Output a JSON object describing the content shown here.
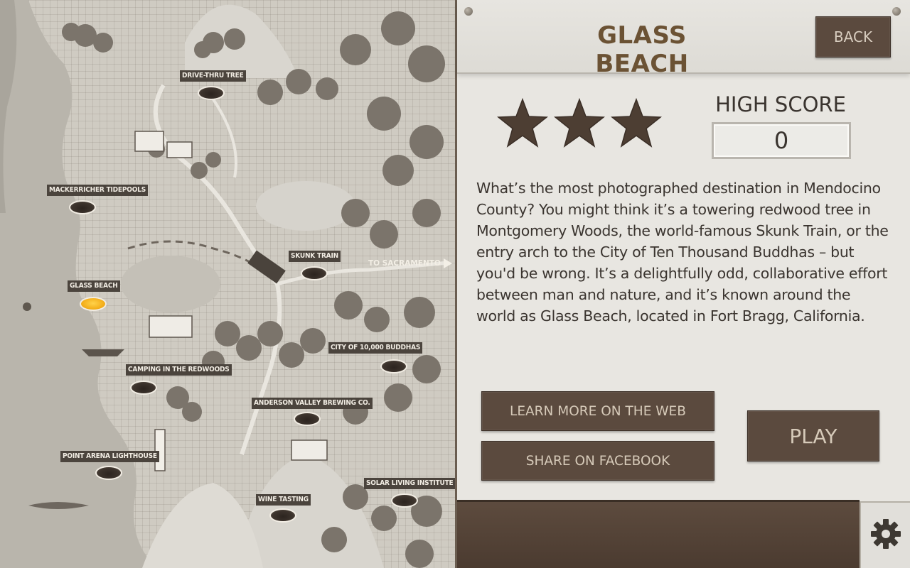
{
  "map": {
    "locations": [
      {
        "id": "drive-thru-tree",
        "label": "DRIVE-THRU TREE",
        "active": false
      },
      {
        "id": "mackerricher-tidepools",
        "label": "MACKERRICHER TIDEPOOLS",
        "active": false
      },
      {
        "id": "skunk-train",
        "label": "SKUNK TRAIN",
        "active": false
      },
      {
        "id": "glass-beach",
        "label": "GLASS BEACH",
        "active": true
      },
      {
        "id": "city-of-10000-buddhas",
        "label": "CITY OF 10,000 BUDDHAS",
        "active": false
      },
      {
        "id": "camping-in-the-redwoods",
        "label": "CAMPING IN THE REDWOODS",
        "active": false
      },
      {
        "id": "anderson-valley-brewing",
        "label": "ANDERSON VALLEY BREWING CO.",
        "active": false
      },
      {
        "id": "point-arena-lighthouse",
        "label": "POINT ARENA LIGHTHOUSE",
        "active": false
      },
      {
        "id": "solar-living-institute",
        "label": "SOLAR LIVING INSTITUTE",
        "active": false
      },
      {
        "id": "wine-tasting",
        "label": "WINE TASTING",
        "active": false
      }
    ],
    "to_sacramento": "TO SACRAMENTO"
  },
  "panel": {
    "title": "GLASS BEACH",
    "back_label": "BACK",
    "stars_earned": 3,
    "stars_total": 3,
    "high_score_label": "HIGH SCORE",
    "high_score_value": "0",
    "description": "What’s the most photographed destination in Mendocino County? You might think it’s a towering redwood tree in Montgomery Woods, the world-famous Skunk Train, or the entry arch to the City of Ten Thousand Buddhas – but you'd be wrong. It’s a delightfully odd, collaborative effort between man and nature, and it’s known around the world as Glass Beach, located in Fort Bragg, California.",
    "learn_more_label": "LEARN MORE ON THE WEB",
    "share_label": "SHARE ON FACEBOOK",
    "play_label": "PLAY",
    "settings_icon": "gear-icon"
  },
  "colors": {
    "accent_title": "#6b5234",
    "button_bg": "#5b4a3e",
    "active_marker": "#f4b01c",
    "star": "#4d3e33"
  }
}
